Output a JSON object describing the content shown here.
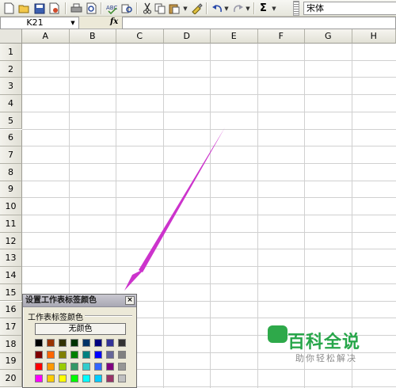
{
  "toolbar": {
    "icons": [
      "new-icon",
      "open-icon",
      "save-icon",
      "permission-icon",
      "print-icon",
      "print-preview-icon",
      "spelling-icon",
      "research-icon",
      "cut-icon",
      "copy-icon",
      "paste-icon",
      "format-painter-icon",
      "undo-icon",
      "redo-icon",
      "autosum-icon"
    ],
    "autosum_symbol": "Σ",
    "font_name": "宋体"
  },
  "formula_bar": {
    "cell_reference": "K21",
    "fx_label": "fx",
    "formula": ""
  },
  "sheet": {
    "columns": [
      "A",
      "B",
      "C",
      "D",
      "E",
      "F",
      "G",
      "H"
    ],
    "rows": [
      "1",
      "2",
      "3",
      "4",
      "5",
      "6",
      "7",
      "8",
      "9",
      "10",
      "11",
      "12",
      "13",
      "14",
      "15",
      "16",
      "17",
      "18",
      "19",
      "20"
    ]
  },
  "dialog": {
    "title": "设置工作表标签颜色",
    "close_symbol": "×",
    "section_label": "工作表标签颜色",
    "no_color_label": "无颜色",
    "palette": [
      [
        "#000000",
        "#993300",
        "#333300",
        "#003300",
        "#003366",
        "#000080",
        "#333399",
        "#333333"
      ],
      [
        "#800000",
        "#ff6600",
        "#808000",
        "#008000",
        "#008080",
        "#0000ff",
        "#666699",
        "#808080"
      ],
      [
        "#ff0000",
        "#ff9900",
        "#99cc00",
        "#339966",
        "#33cccc",
        "#3366ff",
        "#800080",
        "#969696"
      ],
      [
        "#ff00ff",
        "#ffcc00",
        "#ffff00",
        "#00ff00",
        "#00ffff",
        "#00ccff",
        "#993366",
        "#c0c0c0"
      ]
    ]
  },
  "annotation": {
    "arrow_color": "#cc33cc"
  },
  "watermark": {
    "title": "百科全说",
    "subtitle": "助你轻松解决",
    "color": "#27a64a"
  }
}
